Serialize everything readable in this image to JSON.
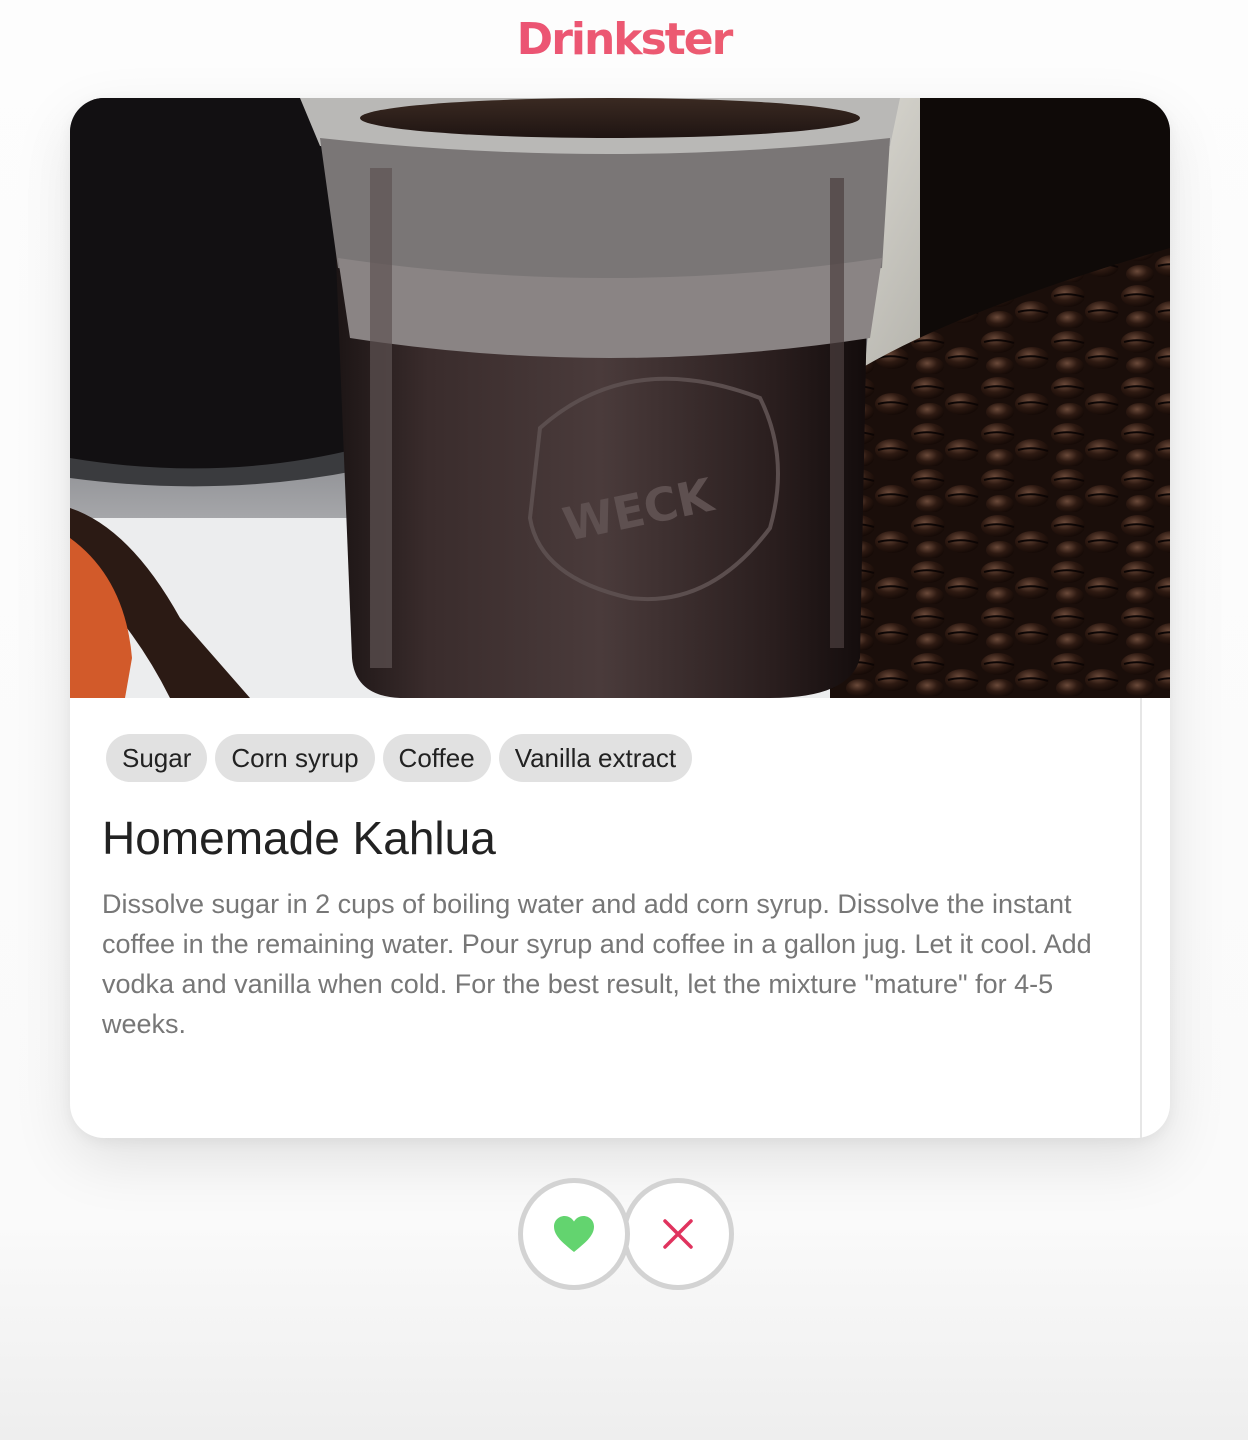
{
  "app": {
    "brand": "Drinkster"
  },
  "card": {
    "image_alt": "Homemade Kahlua in a Weck jar with coffee beans and vanilla pods",
    "tags": [
      "Sugar",
      "Corn syrup",
      "Coffee",
      "Vanilla extract"
    ],
    "title": "Homemade Kahlua",
    "description": "Dissolve sugar in 2 cups of boiling water and add corn syrup. Dissolve the instant coffee in the remaining water. Pour syrup and coffee in a gallon jug. Let it cool. Add vodka and vanilla when cold. For the best result, let the mixture \"mature\" for 4-5 weeks."
  },
  "actions": {
    "like_icon": "heart-icon",
    "dislike_icon": "close-icon"
  },
  "colors": {
    "brand_start": "#e8407a",
    "brand_end": "#f0706a",
    "like": "#63d46f",
    "dislike": "#e0335e",
    "tag_bg": "#e1e1e1"
  }
}
